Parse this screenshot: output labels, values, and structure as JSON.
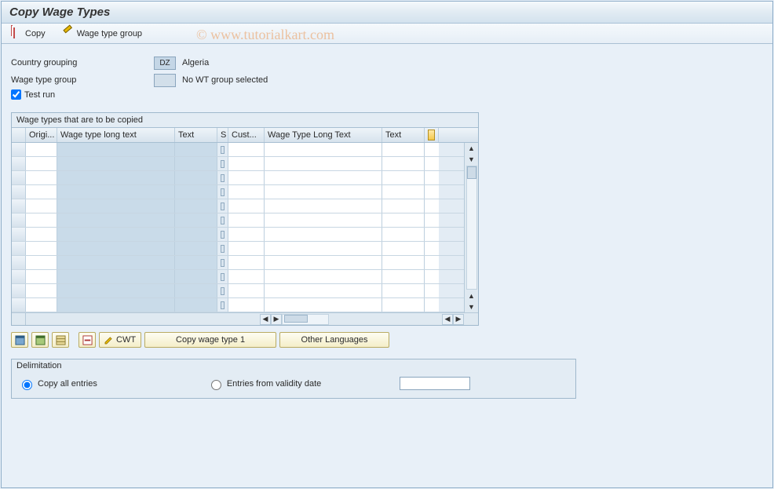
{
  "title": "Copy Wage Types",
  "watermark": "© www.tutorialkart.com",
  "toolbar": {
    "copy_label": "Copy",
    "wage_type_group_label": "Wage type group"
  },
  "form": {
    "country_grouping_label": "Country grouping",
    "country_grouping_value": "DZ",
    "country_grouping_desc": "Algeria",
    "wage_type_group_label": "Wage type group",
    "wage_type_group_value": "",
    "wage_type_group_desc": "No WT group selected",
    "test_run_label": "Test run",
    "test_run_checked": true
  },
  "table": {
    "title": "Wage types that are to be copied",
    "columns": {
      "origi": "Origi...",
      "wage_type_long_text": "Wage type long text",
      "text": "Text",
      "s": "S",
      "cust": "Cust...",
      "wage_type_long_text_2": "Wage Type Long Text",
      "text2": "Text"
    },
    "row_count": 12
  },
  "buttons": {
    "cwt": "CWT",
    "copy_wage_type_1": "Copy wage type 1",
    "other_languages": "Other Languages"
  },
  "delimitation": {
    "title": "Delimitation",
    "copy_all_label": "Copy all entries",
    "entries_from_label": "Entries from validity date",
    "selected": "copy_all",
    "date_value": ""
  }
}
